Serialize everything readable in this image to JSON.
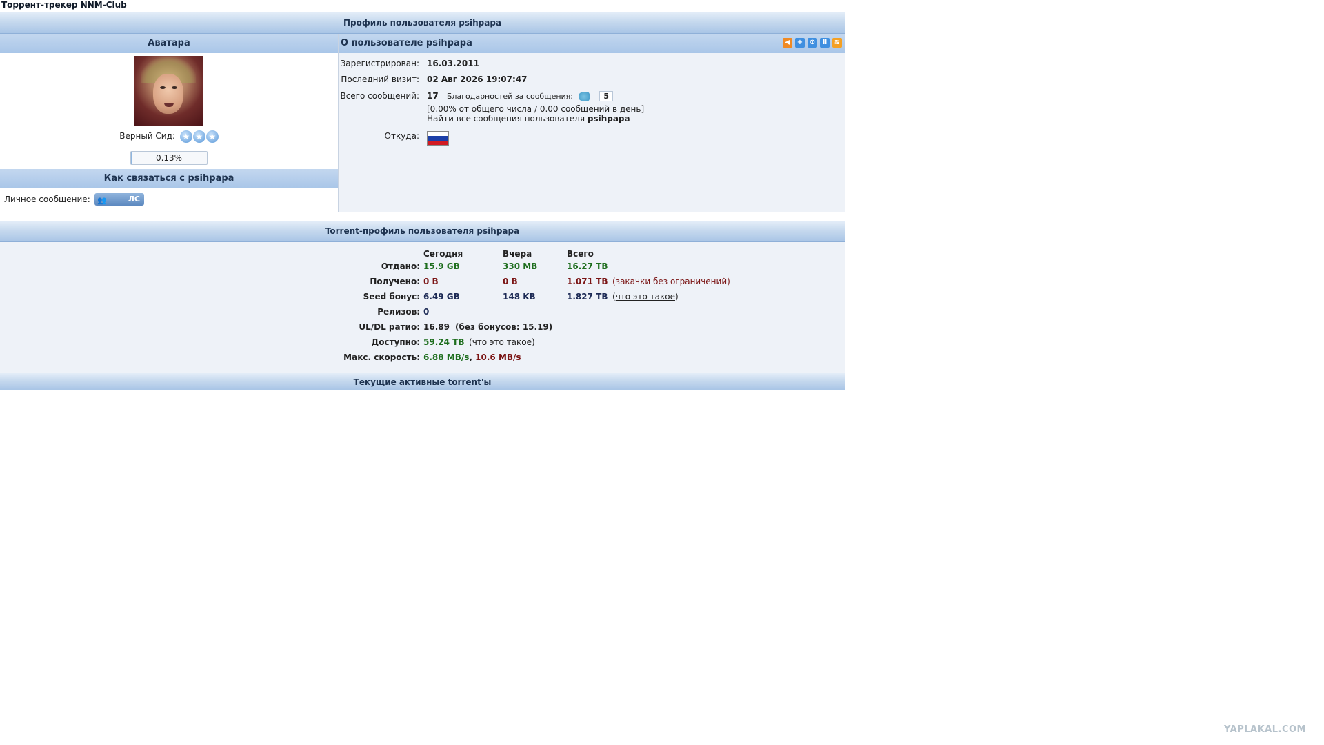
{
  "site_title": "Торрент-трекер NNM-Club",
  "profile_header": "Профиль пользователя psihpapa",
  "avatar_header": "Аватара",
  "about_header": "О пользователе psihpapa",
  "rank": "Верный Сид:",
  "progress": {
    "value": 0.13,
    "label": "0.13%"
  },
  "contact": {
    "header": "Как связаться с psihpapa",
    "pm_label": "Личное сообщение:",
    "pm_button": "ЛС"
  },
  "header_icons": [
    "sound-icon",
    "add-icon",
    "search-icon",
    "pause-icon",
    "rss-icon"
  ],
  "info": {
    "registered_label": "Зарегистрирован:",
    "registered_value": "16.03.2011",
    "last_visit_label": "Последний визит:",
    "last_visit_value": "02 Авг 2026 19:07:47",
    "posts_label": "Всего сообщений:",
    "posts_value": "17",
    "thanks_label": "Благодарностей за сообщения:",
    "thanks_value": "5",
    "posts_stats": "[0.00% от общего числа / 0.00 сообщений в день]",
    "find_posts_prefix": "Найти все сообщения пользователя",
    "find_posts_user": "psihpapa",
    "from_label": "Откуда:"
  },
  "torrent": {
    "header": "Torrent-профиль пользователя psihpapa",
    "columns": [
      "Сегодня",
      "Вчера",
      "Всего"
    ],
    "rows": {
      "uploaded": {
        "label": "Отдано:",
        "today": "15.9 GB",
        "yesterday": "330 MB",
        "total": "16.27 TB"
      },
      "downloaded": {
        "label": "Получено:",
        "today": "0 B",
        "yesterday": "0 B",
        "total": "1.071 TB",
        "note": "(закачки без ограничений)"
      },
      "seed_bonus": {
        "label": "Seed бонус:",
        "today": "6.49 GB",
        "yesterday": "148 KB",
        "total": "1.827 TB",
        "note_open": "(",
        "note_link": "что это такое",
        "note_close": ")"
      },
      "releases": {
        "label": "Релизов:",
        "value": "0"
      },
      "ratio": {
        "label": "UL/DL ратио:",
        "value": "16.89",
        "extra": "(без бонусов: 15.19)"
      },
      "available": {
        "label": "Доступно:",
        "value": "59.24 TB",
        "note_open": "(",
        "note_link": "что это такое",
        "note_close": ")"
      },
      "max_speed": {
        "label": "Макс. скорость:",
        "up": "6.88 MB/s",
        "sep": ",",
        "down": "10.6 MB/s"
      }
    }
  },
  "active_header": "Текущие активные torrent'ы",
  "watermark": "YAPLAKAL.COM",
  "colors": {
    "header_blue": "#a9c5e6",
    "panel_bg": "#eef2f8",
    "green": "#1e6e1e",
    "dark_red": "#7a1414",
    "navy": "#1c2a55"
  }
}
